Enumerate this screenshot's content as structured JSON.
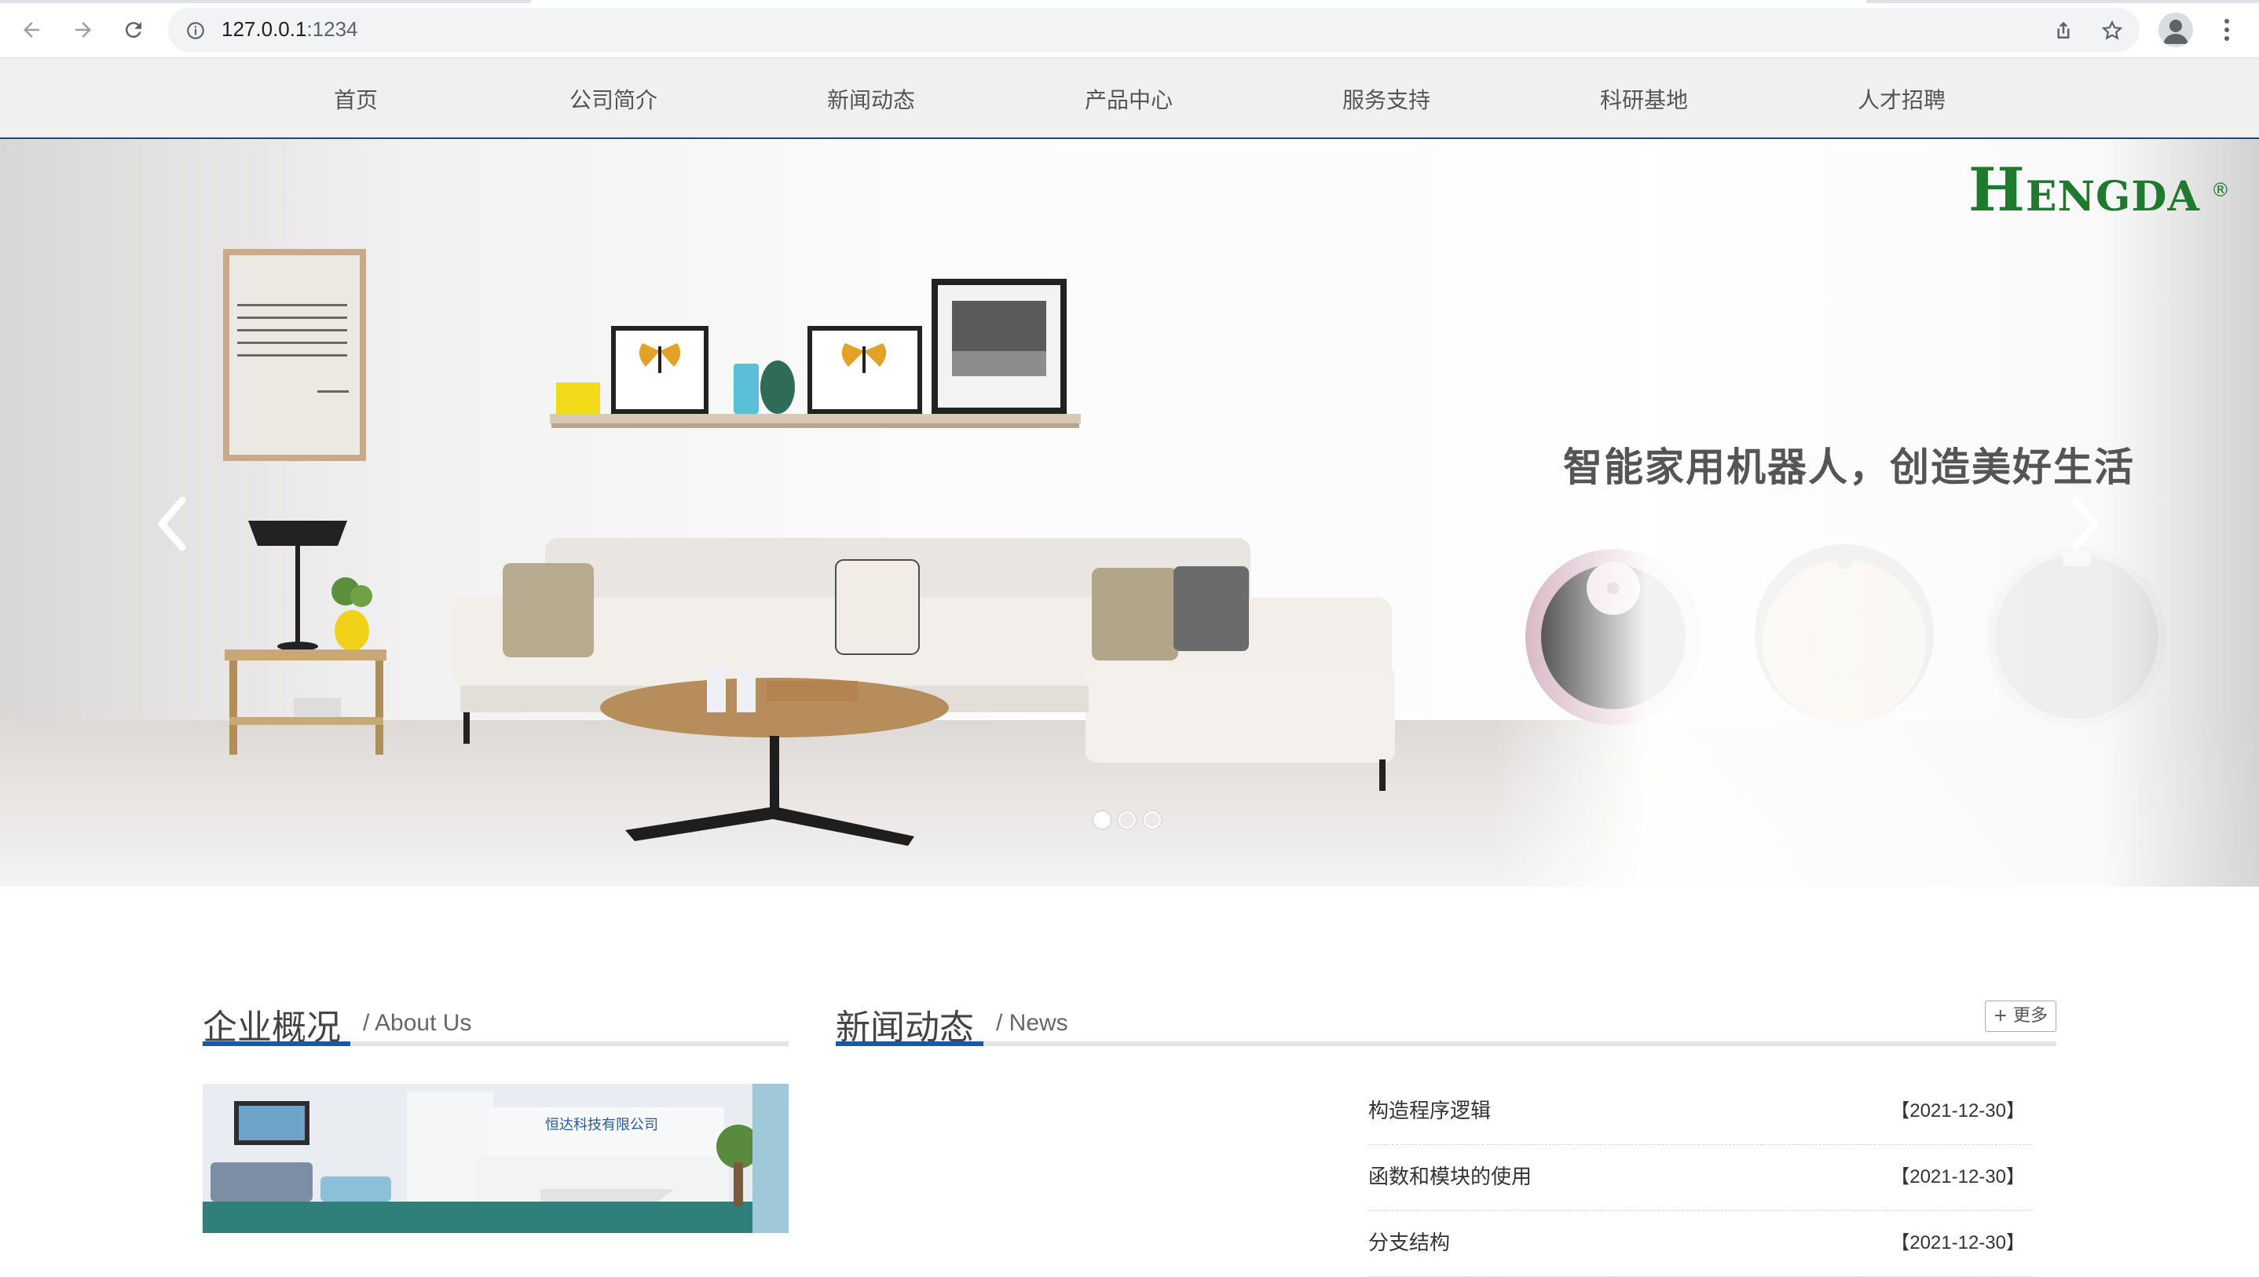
{
  "browser": {
    "url_host": "127.0.0.1",
    "url_port": ":1234"
  },
  "nav": {
    "items": [
      {
        "label": "首页"
      },
      {
        "label": "公司简介"
      },
      {
        "label": "新闻动态"
      },
      {
        "label": "产品中心"
      },
      {
        "label": "服务支持"
      },
      {
        "label": "科研基地"
      },
      {
        "label": "人才招聘"
      }
    ]
  },
  "banner": {
    "logo_first": "H",
    "logo_rest": "ENGDA",
    "logo_mark": "®",
    "slogan": "智能家用机器人，创造美好生活",
    "poster_text": "the end, only three thi ater: how much you loved w gently you lived, and w gracefully you let go hings not meant for you. uddha",
    "active_slide": 1,
    "slide_count": 3,
    "company_sign": "恒达科技有限公司"
  },
  "about": {
    "title": "企业概况",
    "subtitle": "/ About Us"
  },
  "news": {
    "title": "新闻动态",
    "subtitle": "/ News",
    "more_label": "+ 更多",
    "items": [
      {
        "title": "构造程序逻辑",
        "date": "【2021-12-30】"
      },
      {
        "title": "函数和模块的使用",
        "date": "【2021-12-30】"
      },
      {
        "title": "分支结构",
        "date": "【2021-12-30】"
      }
    ]
  },
  "colors": {
    "accent": "#1a5aa0",
    "nav_border": "#1a4a7a",
    "logo_green": "#1f7a2e"
  }
}
